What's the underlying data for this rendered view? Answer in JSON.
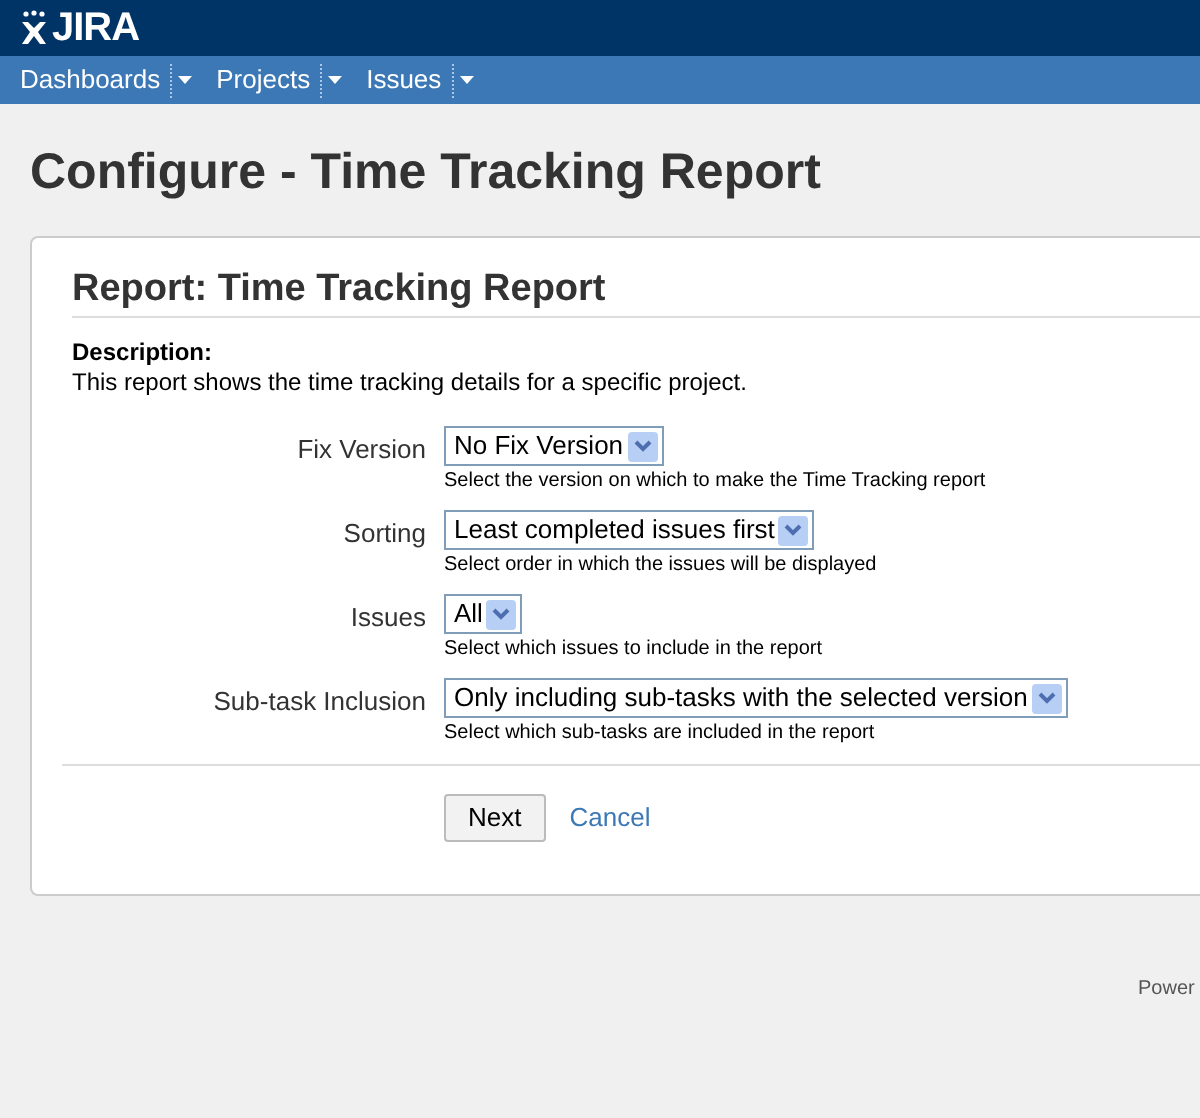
{
  "header": {
    "logo": "JIRA"
  },
  "nav": [
    {
      "label": "Dashboards"
    },
    {
      "label": "Projects"
    },
    {
      "label": "Issues"
    }
  ],
  "page_title": "Configure - Time Tracking Report",
  "report": {
    "title": "Report: Time Tracking Report",
    "description_label": "Description:",
    "description": "This report shows the time tracking details for a specific project.",
    "fields": [
      {
        "label": "Fix Version",
        "value": "No Fix Version",
        "hint": "Select the version on which to make the Time Tracking report"
      },
      {
        "label": "Sorting",
        "value": "Least completed issues first",
        "hint": "Select order in which the issues will be displayed"
      },
      {
        "label": "Issues",
        "value": "All",
        "hint": "Select which issues to include in the report"
      },
      {
        "label": "Sub-task Inclusion",
        "value": "Only including sub-tasks with the selected version",
        "hint": "Select which sub-tasks are included in the report"
      }
    ],
    "buttons": {
      "next": "Next",
      "cancel": "Cancel"
    }
  },
  "footer": "Power"
}
